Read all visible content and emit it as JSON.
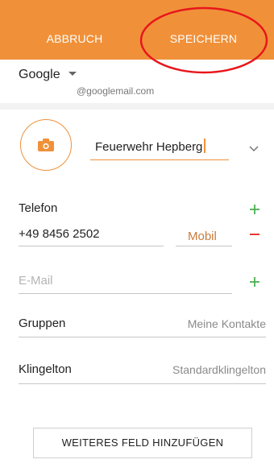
{
  "appbar": {
    "cancel_label": "ABBRUCH",
    "save_label": "SPEICHERN",
    "color": "#f0913a"
  },
  "account": {
    "name": "Google",
    "email": "@googlemail.com"
  },
  "contact": {
    "name": "Feuerwehr Hepberg"
  },
  "phone": {
    "label": "Telefon",
    "value": "+49 8456 2502",
    "type": "Mobil"
  },
  "email": {
    "placeholder": "E-Mail"
  },
  "groups": {
    "label": "Gruppen",
    "value": "Meine Kontakte"
  },
  "ringtone": {
    "label": "Klingelton",
    "value": "Standardklingelton"
  },
  "add_field_label": "WEITERES FELD HINZUFÜGEN",
  "icons": {
    "camera": "camera-icon",
    "expand": "chevron-down-icon",
    "add": "plus-icon",
    "remove": "minus-icon"
  },
  "colors": {
    "accent": "#f0913a",
    "add_green": "#4caf50",
    "remove_red": "#e53935",
    "highlight_annotation": "#e8161b"
  }
}
